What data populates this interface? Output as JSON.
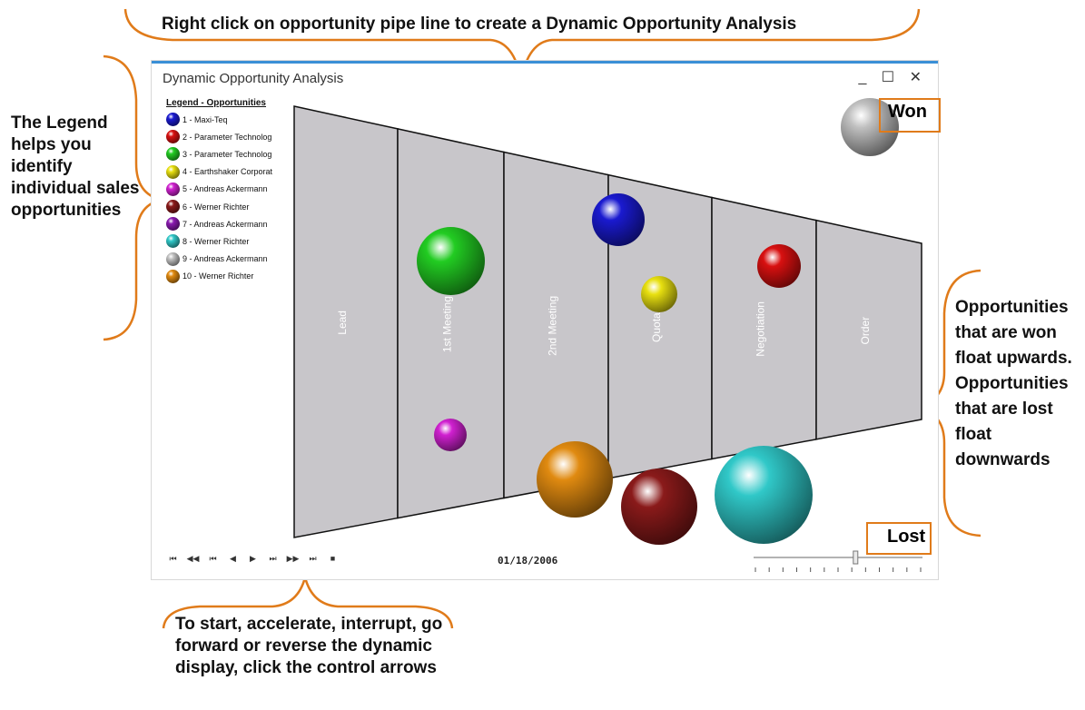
{
  "callouts": {
    "top": "Right click on opportunity pipe line to create a Dynamic Opportunity Analysis",
    "left": "The Legend helps you identify individual sales opportunities",
    "right": "Opportunities that are won float upwards. Opportunities that are lost float downwards",
    "bottom": "To start, accelerate, interrupt, go forward or reverse the dynamic display, click the control arrows"
  },
  "window": {
    "title": "Dynamic Opportunity Analysis",
    "minimize": "_",
    "maximize": "☐",
    "close": "✕"
  },
  "legend": {
    "title": "Legend - Opportunities",
    "items": [
      {
        "label": "1 - Maxi-Teq",
        "color": "#1a1ad0"
      },
      {
        "label": "2 - Parameter Technolog",
        "color": "#d81010"
      },
      {
        "label": "3 - Parameter Technolog",
        "color": "#22cc22"
      },
      {
        "label": "4 - Earthshaker Corporat",
        "color": "#e8e010"
      },
      {
        "label": "5 - Andreas Ackermann",
        "color": "#d020d0"
      },
      {
        "label": "6 - Werner Richter",
        "color": "#8a1a1a"
      },
      {
        "label": "7 - Andreas Ackermann",
        "color": "#8a1ab0"
      },
      {
        "label": "8 - Werner Richter",
        "color": "#30c8c8"
      },
      {
        "label": "9 - Andreas Ackermann",
        "color": "#c0c0c0"
      },
      {
        "label": "10 - Werner Richter",
        "color": "#e08a10"
      }
    ]
  },
  "pipeline": {
    "stages": [
      "Lead",
      "1st Meeting",
      "2nd Meeting",
      "Quota",
      "Negotiation",
      "Order"
    ],
    "fill": "#c8c6ca"
  },
  "tags": {
    "won": "Won",
    "lost": "Lost"
  },
  "controls": {
    "buttons": [
      {
        "name": "first-button",
        "glyph": "⏮"
      },
      {
        "name": "rewind-button",
        "glyph": "◀◀"
      },
      {
        "name": "prev-step-button",
        "glyph": "⏮"
      },
      {
        "name": "reverse-button",
        "glyph": "◀"
      },
      {
        "name": "play-button",
        "glyph": "▶"
      },
      {
        "name": "next-step-button",
        "glyph": "⏭"
      },
      {
        "name": "forward-button",
        "glyph": "▶▶"
      },
      {
        "name": "last-button",
        "glyph": "⏭"
      },
      {
        "name": "stop-button",
        "glyph": "■"
      }
    ],
    "date": "01/18/2006",
    "slider_position": 0.6
  },
  "accent": "#e07b1a"
}
